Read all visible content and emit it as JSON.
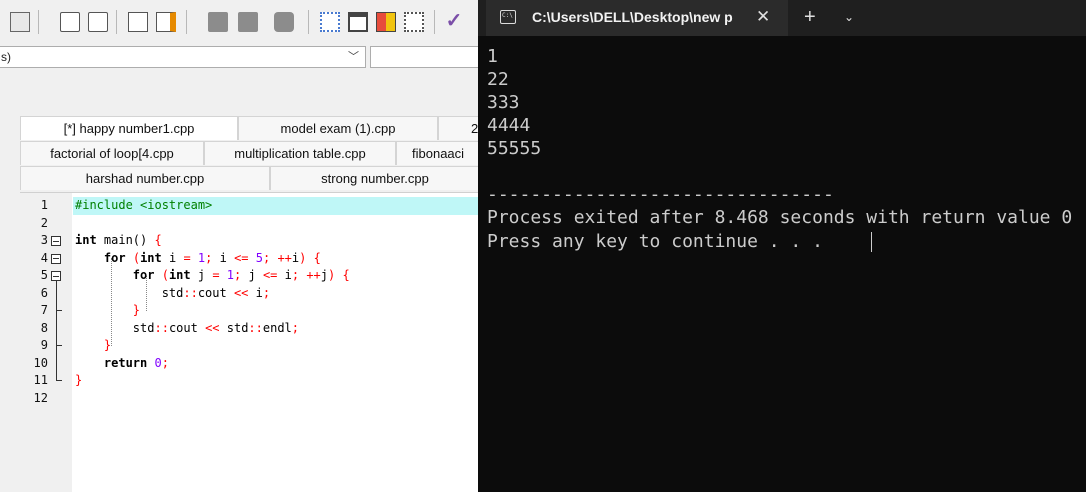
{
  "ide": {
    "scope_combo": {
      "value": "s)"
    },
    "tab_rows": [
      [
        "[*] happy number1.cpp",
        "model exam (1).cpp",
        "2"
      ],
      [
        "factorial of loop[4.cpp",
        "multiplication table.cpp",
        "fibonaaci"
      ],
      [
        "harshad number.cpp",
        "strong number.cpp"
      ]
    ],
    "line_numbers": [
      "1",
      "2",
      "3",
      "4",
      "5",
      "6",
      "7",
      "8",
      "9",
      "10",
      "11",
      "12"
    ]
  },
  "code": [
    "#include <iostream>",
    "",
    "int main() {",
    "    for (int i = 1; i <= 5; ++i) {",
    "        for (int j = 1; j <= i; ++j) {",
    "            std::cout << i;",
    "        }",
    "        std::cout << std::endl;",
    "    }",
    "    return 0;",
    "}",
    ""
  ],
  "console": {
    "tab_title": "C:\\Users\\DELL\\Desktop\\new p",
    "tab_close": "✕",
    "new_tab": "+",
    "dropdown": "⌄",
    "output": [
      "1",
      "22",
      "333",
      "4444",
      "55555",
      "",
      "--------------------------------",
      "Process exited after 8.468 seconds with return value 0",
      "Press any key to continue . . . "
    ]
  },
  "colors": {
    "console_bg": "#0c0c0c",
    "console_text": "#cccccc",
    "current_line": "#bff7f7",
    "keyword_symbols": "#ff0000",
    "number": "#8000ff",
    "preprocessor": "#008000"
  }
}
